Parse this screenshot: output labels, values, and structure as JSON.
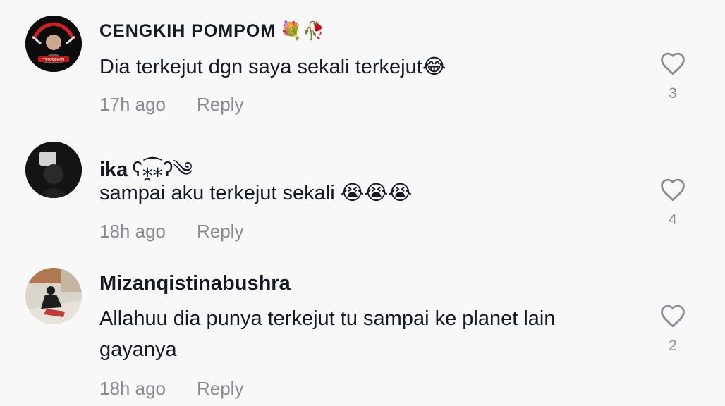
{
  "comments": [
    {
      "username": "CENGKIH POMPOM",
      "username_deco": "💐🥀",
      "text": "Dia terkejut dgn saya sekali terkejut😂",
      "time": "17h ago",
      "reply_label": "Reply",
      "likes": "3",
      "avatar_text": "TERSAKITI"
    },
    {
      "username": "ika",
      "username_deco": "ʕ⁎̯͡⁎ʔ༄",
      "text": "sampai aku terkejut sekali 😭😭😭",
      "time": "18h ago",
      "reply_label": "Reply",
      "likes": "4"
    },
    {
      "username": "Mizanqistinabushra",
      "username_deco": "",
      "text": "Allahuu dia punya terkejut tu sampai ke planet lain gayanya",
      "time": "18h ago",
      "reply_label": "Reply",
      "likes": "2"
    }
  ],
  "colors": {
    "background": "#f8f8f8",
    "primary_text": "#161823",
    "secondary_text": "#8a8b91"
  },
  "icons": {
    "like": "heart-outline-icon"
  }
}
